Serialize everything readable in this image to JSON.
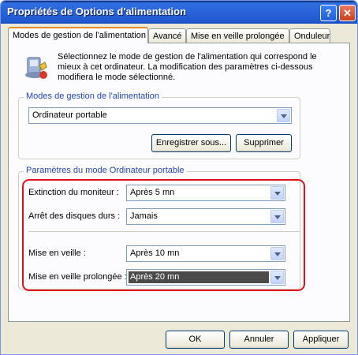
{
  "window": {
    "title": "Propriétés de Options d'alimentation",
    "help_glyph": "?",
    "close_glyph": "✕"
  },
  "tabs": [
    {
      "label": "Modes de gestion de l'alimentation"
    },
    {
      "label": "Avancé"
    },
    {
      "label": "Mise en veille prolongée"
    },
    {
      "label": "Onduleur"
    }
  ],
  "description": "Sélectionnez le mode de gestion de l'alimentation qui correspond le mieux à cet ordinateur. La modification des paramètres ci-dessous modifiera le mode sélectionné.",
  "schemes": {
    "group_label": "Modes de gestion de l'alimentation",
    "selected": "Ordinateur portable",
    "save_as_label": "Enregistrer sous...",
    "delete_label": "Supprimer"
  },
  "settings": {
    "group_label": "Paramètres du mode Ordinateur portable",
    "monitor_label": "Extinction du moniteur :",
    "monitor_value": "Après 5 mn",
    "disks_label": "Arrêt des disques durs :",
    "disks_value": "Jamais",
    "standby_label": "Mise en veille :",
    "standby_value": "Après 10 mn",
    "hibernate_label": "Mise en veille prolongée :",
    "hibernate_value": "Après 20 mn"
  },
  "footer": {
    "ok_label": "OK",
    "cancel_label": "Annuler",
    "apply_label": "Appliquer"
  },
  "colors": {
    "title_bar": "#2a63d9",
    "highlight_box": "#e0101a",
    "group_label": "#2246b0"
  }
}
